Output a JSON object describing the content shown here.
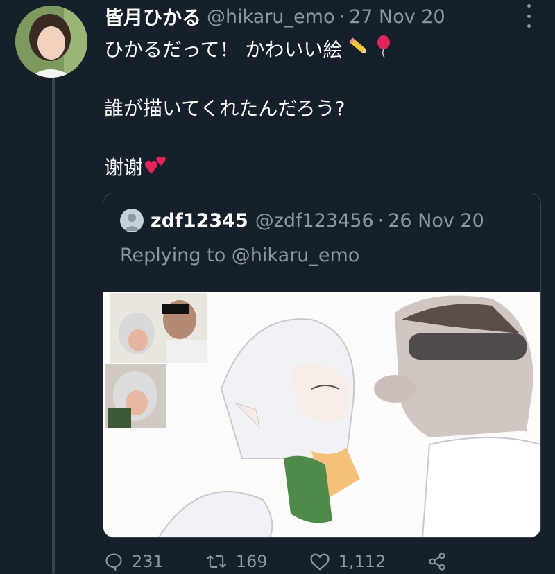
{
  "tweet": {
    "display_name": "皆月ひかる",
    "handle": "@hikaru_emo",
    "separator": "·",
    "date": "27 Nov 20",
    "lines": [
      "ひかるだって！ かわいい絵",
      "誰が描いてくれたんだろう?",
      "谢谢"
    ],
    "emojis": [
      "pencil-emoji",
      "balloon-emoji",
      "two-hearts-emoji"
    ]
  },
  "quoted": {
    "display_name": "zdf12345",
    "handle": "@zdf123456",
    "separator": "·",
    "date": "26 Nov 20",
    "replying_to": "Replying to @hikaru_emo"
  },
  "actions": {
    "replies": "231",
    "retweets": "169",
    "likes": "1,112"
  },
  "icons": [
    "reply-icon",
    "retweet-icon",
    "like-icon",
    "share-icon",
    "more-icon"
  ],
  "colors": {
    "background": "#15202b",
    "secondary_text": "#8899a6",
    "border": "#38444d"
  }
}
